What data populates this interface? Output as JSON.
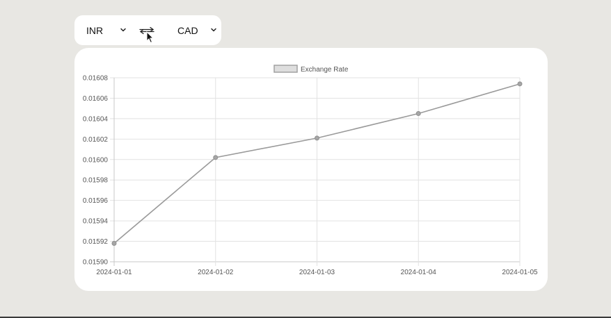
{
  "currency": {
    "from": "INR",
    "to": "CAD"
  },
  "icons": {
    "from_dropdown": "chevron-down-icon",
    "to_dropdown": "chevron-down-icon",
    "swap": "swap-arrows-icon",
    "cursor": "mouse-pointer-icon"
  },
  "colors": {
    "page_background": "#e8e7e3",
    "card_background": "#ffffff",
    "series_line": "#9a9a9a",
    "grid": "#e2e2e2"
  },
  "chart_data": {
    "type": "line",
    "title": "",
    "xlabel": "",
    "ylabel": "",
    "categories": [
      "2024-01-01",
      "2024-01-02",
      "2024-01-03",
      "2024-01-04",
      "2024-01-05"
    ],
    "series": [
      {
        "name": "Exchange Rate",
        "values": [
          0.015918,
          0.016002,
          0.016021,
          0.016045,
          0.016074
        ]
      }
    ],
    "ylim": [
      0.0159,
      0.01608
    ],
    "yticks": [
      "0.01590",
      "0.01592",
      "0.01594",
      "0.01596",
      "0.01598",
      "0.01600",
      "0.01602",
      "0.01604",
      "0.01606",
      "0.01608"
    ],
    "grid": true,
    "legend": "top-center"
  }
}
